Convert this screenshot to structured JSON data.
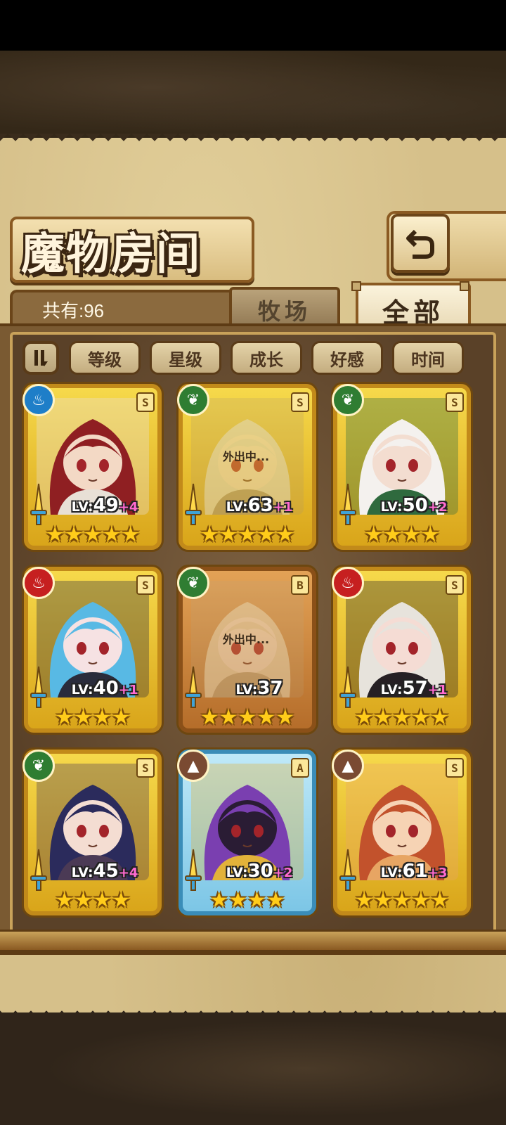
{
  "header": {
    "title": "魔物房间"
  },
  "inventory": {
    "count_label": "共有:96"
  },
  "tabs": [
    {
      "label": "牧场",
      "active": false
    },
    {
      "label": "全部",
      "active": true
    }
  ],
  "sort_buttons": [
    "等级",
    "星级",
    "成长",
    "好感",
    "时间"
  ],
  "cards": [
    {
      "element": "water",
      "grade": "S",
      "frame": "gold",
      "lv_label": "LV:",
      "level": "49",
      "plus": "+4",
      "stars": 5,
      "away": "",
      "portrait_colors": [
        "#8f1f22",
        "#f3d9c5",
        "#e8e0d6"
      ]
    },
    {
      "element": "wood",
      "grade": "S",
      "frame": "gold",
      "lv_label": "LV:",
      "level": "63",
      "plus": "+1",
      "stars": 5,
      "away": "外出中...",
      "portrait_colors": [
        "#d8d1c1",
        "#e6d6c4",
        "#a39076"
      ]
    },
    {
      "element": "wood",
      "grade": "S",
      "frame": "gold",
      "lv_label": "LV:",
      "level": "50",
      "plus": "+2",
      "stars": 4,
      "away": "",
      "portrait_colors": [
        "#f4f1ee",
        "#f3ddd0",
        "#2f6a3e"
      ]
    },
    {
      "element": "fire",
      "grade": "S",
      "frame": "gold",
      "lv_label": "LV:",
      "level": "40",
      "plus": "+1",
      "stars": 4,
      "away": "",
      "portrait_colors": [
        "#58b9e4",
        "#f6e2e3",
        "#2a2c3c"
      ]
    },
    {
      "element": "wood",
      "grade": "B",
      "frame": "bronze",
      "lv_label": "LV:",
      "level": "37",
      "plus": "",
      "stars": 5,
      "away": "外出中...",
      "portrait_colors": [
        "#e2d6b4",
        "#efe2cd",
        "#b9a780"
      ]
    },
    {
      "element": "fire",
      "grade": "S",
      "frame": "gold",
      "lv_label": "LV:",
      "level": "57",
      "plus": "+1",
      "stars": 5,
      "away": "",
      "portrait_colors": [
        "#e7e3dc",
        "#f5dcd4",
        "#262024"
      ]
    },
    {
      "element": "wood",
      "grade": "S",
      "frame": "gold",
      "lv_label": "LV:",
      "level": "45",
      "plus": "+4",
      "stars": 4,
      "away": "",
      "portrait_colors": [
        "#2b2b5c",
        "#f4ddd2",
        "#4b3a55"
      ]
    },
    {
      "element": "earth",
      "grade": "A",
      "frame": "blue",
      "lv_label": "LV:",
      "level": "30",
      "plus": "+2",
      "stars": 4,
      "away": "",
      "portrait_colors": [
        "#7a3fb0",
        "#2a1c34",
        "#e2b23a"
      ]
    },
    {
      "element": "earth",
      "grade": "S",
      "frame": "gold",
      "lv_label": "LV:",
      "level": "61",
      "plus": "+3",
      "stars": 5,
      "away": "",
      "portrait_colors": [
        "#c2522c",
        "#f6d3b4",
        "#e7a563"
      ]
    }
  ],
  "colors": {
    "parchment": "#d6c08a",
    "panel": "#7a5a32",
    "gold_frame": "#f2cf3e",
    "plus_text": "#ff6ad0",
    "star": "#ffcc1a"
  }
}
